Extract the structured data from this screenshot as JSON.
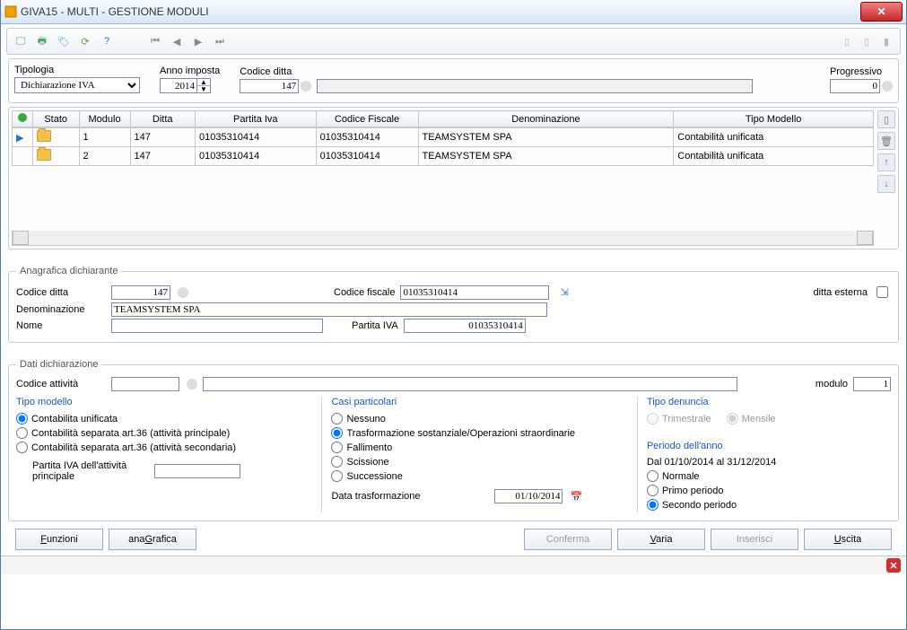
{
  "title": "GIVA15  - MULTI -  GESTIONE MODULI",
  "filters": {
    "tipologia_label": "Tipologia",
    "tipologia_value": "Dichiarazione IVA",
    "anno_label": "Anno imposta",
    "anno_value": "2014",
    "codice_ditta_label": "Codice ditta",
    "codice_ditta_value": "147",
    "progressivo_label": "Progressivo",
    "progressivo_value": "0"
  },
  "grid": {
    "headers": [
      "",
      "Stato",
      "Modulo",
      "Ditta",
      "Partita Iva",
      "Codice Fiscale",
      "Denominazione",
      "Tipo Modello"
    ],
    "rows": [
      {
        "sel": "▶",
        "modulo": "1",
        "ditta": "147",
        "piva": "01035310414",
        "cf": "01035310414",
        "den": "TEAMSYSTEM SPA",
        "tm": "Contabilità unificata"
      },
      {
        "sel": "",
        "modulo": "2",
        "ditta": "147",
        "piva": "01035310414",
        "cf": "01035310414",
        "den": "TEAMSYSTEM SPA",
        "tm": "Contabilità unificata"
      }
    ]
  },
  "anagrafica": {
    "legend": "Anagrafica dichiarante",
    "codice_ditta_label": "Codice ditta",
    "codice_ditta_value": "147",
    "codice_fiscale_label": "Codice fiscale",
    "codice_fiscale_value": "01035310414",
    "ditta_esterna_label": "ditta esterna",
    "denominazione_label": "Denominazione",
    "denominazione_value": "TEAMSYSTEM SPA",
    "nome_label": "Nome",
    "nome_value": "",
    "partita_iva_label": "Partita IVA",
    "partita_iva_value": "01035310414"
  },
  "dich": {
    "legend": "Dati dichiarazione",
    "codice_attivita_label": "Codice attività",
    "codice_attivita_value": "",
    "desc_attivita_value": "",
    "modulo_label": "modulo",
    "modulo_value": "1",
    "tipo_modello": {
      "title": "Tipo modello",
      "opt1": "Contabilita unificata",
      "opt2": "Contabilità separata art.36 (attività principale)",
      "opt3": "Contabilità separata art.36 (attività secondaria)",
      "piva_label": "Partita IVA dell'attività principale",
      "piva_value": ""
    },
    "casi": {
      "title": "Casi particolari",
      "opt1": "Nessuno",
      "opt2": "Trasformazione sostanziale/Operazioni straordinarie",
      "opt3": "Fallimento",
      "opt4": "Scissione",
      "opt5": "Successione",
      "data_label": "Data trasformazione",
      "data_value": "01/10/2014"
    },
    "denuncia": {
      "title": "Tipo denuncia",
      "opt1": "Trimestrale",
      "opt2": "Mensile",
      "periodo_title": "Periodo dell'anno",
      "periodo_range": "Dal 01/10/2014 al 31/12/2014",
      "p1": "Normale",
      "p2": "Primo periodo",
      "p3": "Secondo periodo"
    }
  },
  "footer": {
    "funzioni": "Funzioni",
    "anagrafica": "anaGrafica",
    "conferma": "Conferma",
    "varia": "Varia",
    "inserisci": "Inserisci",
    "uscita": "Uscita"
  }
}
